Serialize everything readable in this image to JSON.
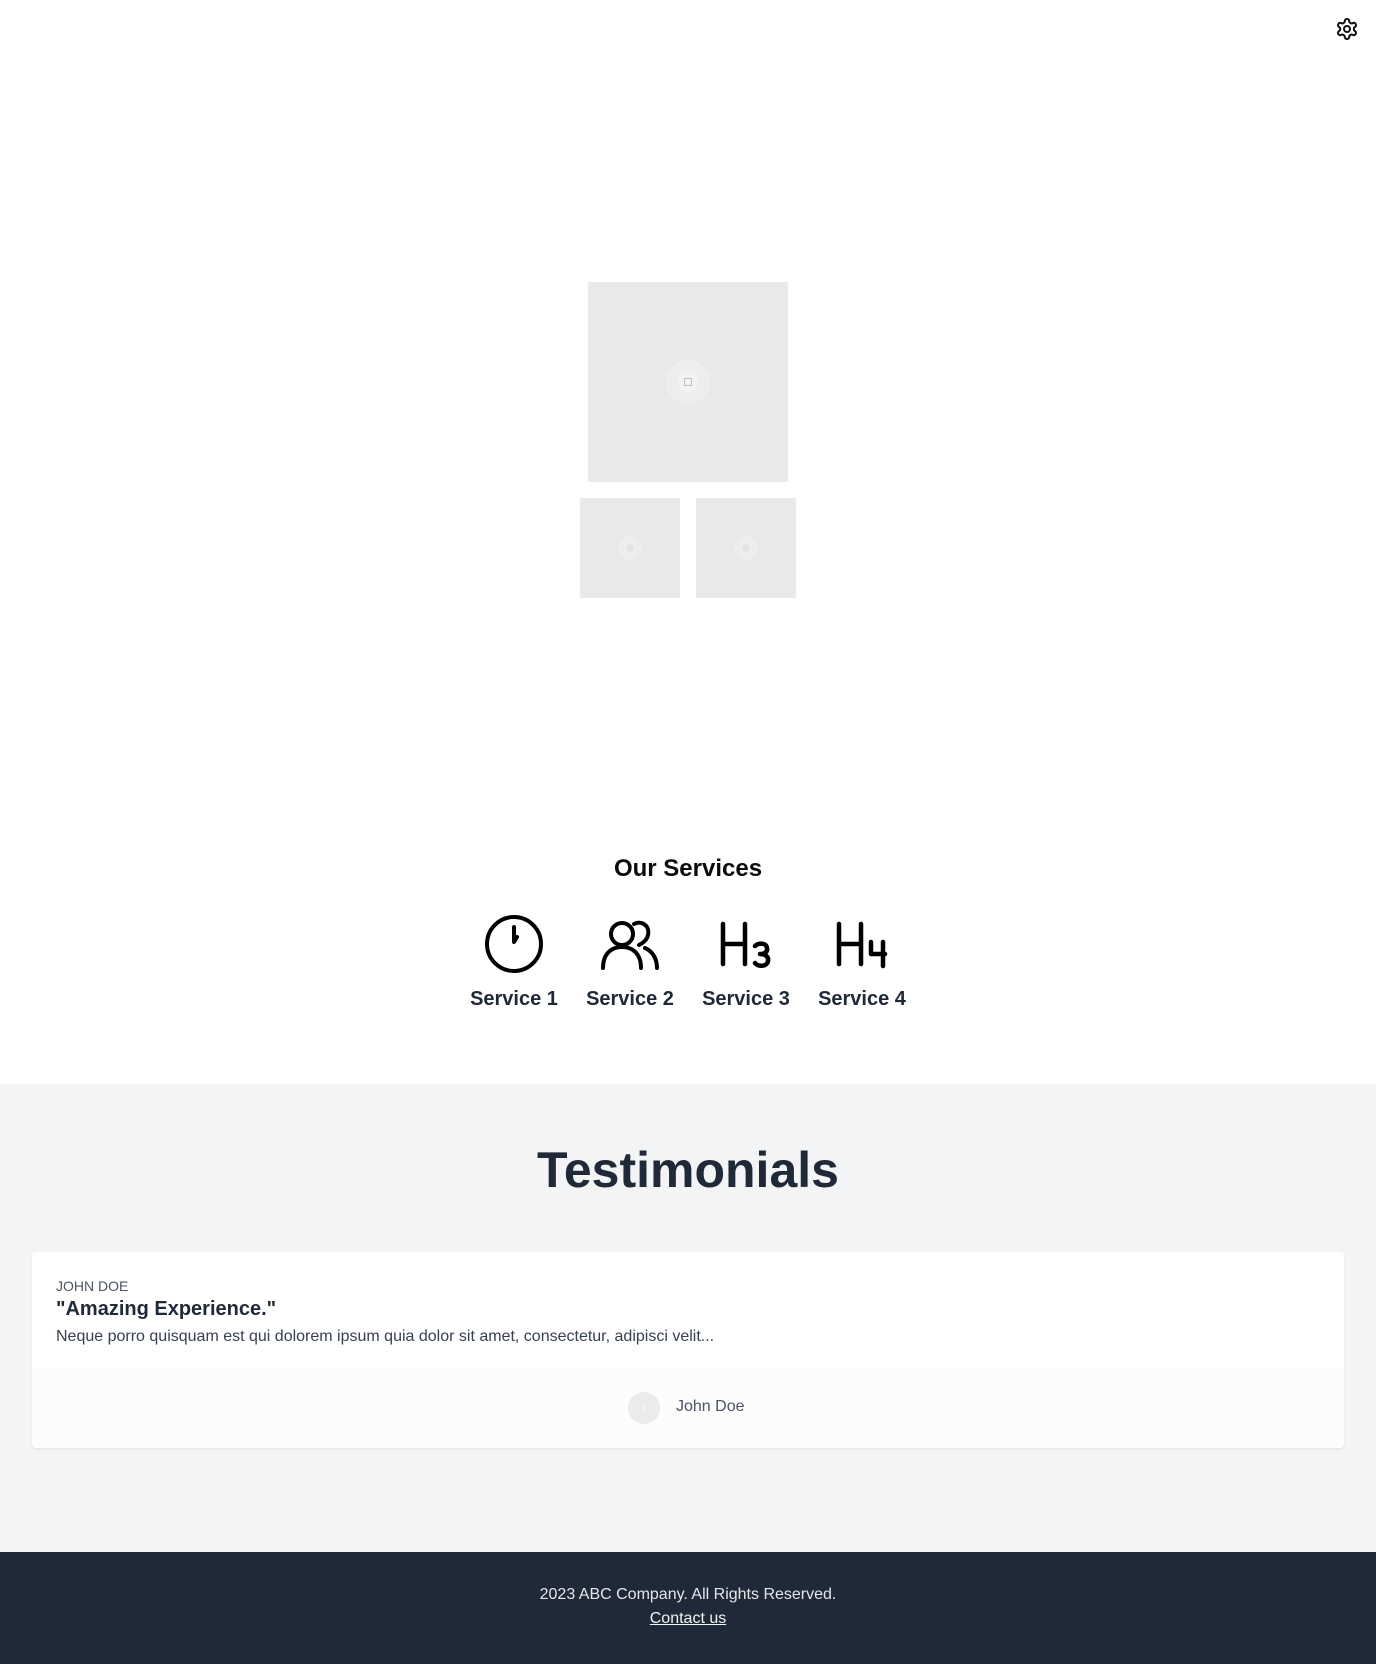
{
  "header": {
    "settings_icon": "gear-icon"
  },
  "gallery": {
    "main_image": "image-placeholder-icon",
    "thumbnails": [
      "image-placeholder",
      "image-placeholder"
    ]
  },
  "services": {
    "title": "Our Services",
    "items": [
      {
        "label": "Service 1",
        "icon": "clock-icon"
      },
      {
        "label": "Service 2",
        "icon": "users-icon"
      },
      {
        "label": "Service 3",
        "icon": "heading-3-icon"
      },
      {
        "label": "Service 4",
        "icon": "heading-4-icon"
      }
    ]
  },
  "testimonials": {
    "title": "Testimonials",
    "items": [
      {
        "author_upper": "JOHN DOE",
        "quote": "\"Amazing Experience.\"",
        "body": "Neque porro quisquam est qui dolorem ipsum quia dolor sit amet, consectetur, adipisci velit...",
        "author_name": "John Doe"
      }
    ]
  },
  "footer": {
    "copyright": "2023 ABC Company. All Rights Reserved.",
    "contact": "Contact us"
  },
  "colors": {
    "text_dark": "#1f2937",
    "section_bg": "#f3f4f6",
    "footer_bg": "#1f2937",
    "placeholder": "#e9e9e9"
  }
}
